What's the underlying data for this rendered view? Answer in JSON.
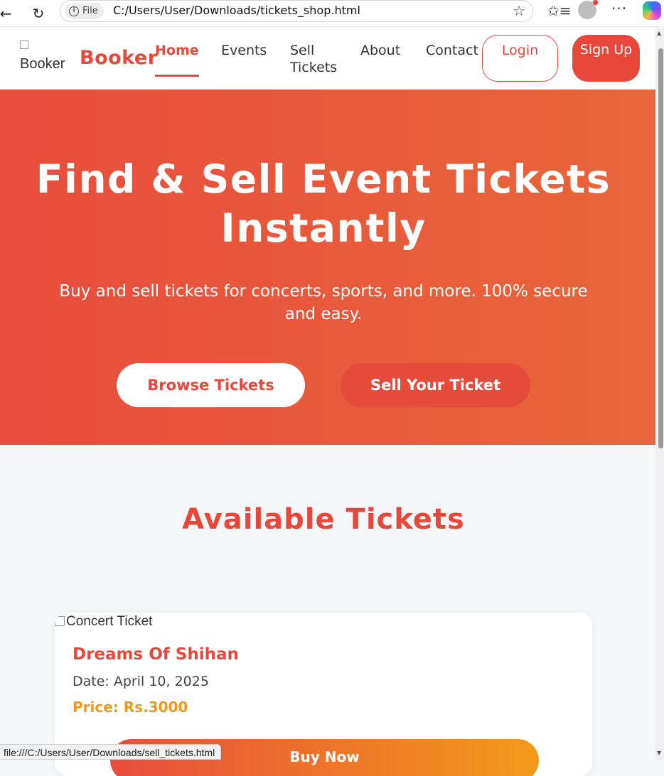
{
  "browser": {
    "file_chip": "File",
    "url": "C:/Users/User/Downloads/tickets_shop.html",
    "status_url": "file:///C:/Users/User/Downloads/sell_tickets.html"
  },
  "nav": {
    "logo_alt": "Booker",
    "brand": "Booker",
    "links": [
      "Home",
      "Events",
      "Sell Tickets",
      "About",
      "Contact"
    ],
    "login": "Login",
    "signup": "Sign Up"
  },
  "hero": {
    "title": "Find & Sell Event Tickets Instantly",
    "subtitle": "Buy and sell tickets for concerts, sports, and more. 100% secure and easy.",
    "browse": "Browse Tickets",
    "sell": "Sell Your Ticket"
  },
  "tickets": {
    "section_title": "Available Tickets",
    "items": [
      {
        "image_alt": "Concert Ticket",
        "title": "Dreams Of Shihan",
        "date": "Date: April 10, 2025",
        "price": "Price: Rs.3000",
        "buy": "Buy Now"
      }
    ]
  },
  "colors": {
    "brand": "#e8483c",
    "accent_orange": "#f09a1c",
    "hero_gradient_start": "#e84d3d",
    "hero_gradient_end": "#e9663a"
  }
}
